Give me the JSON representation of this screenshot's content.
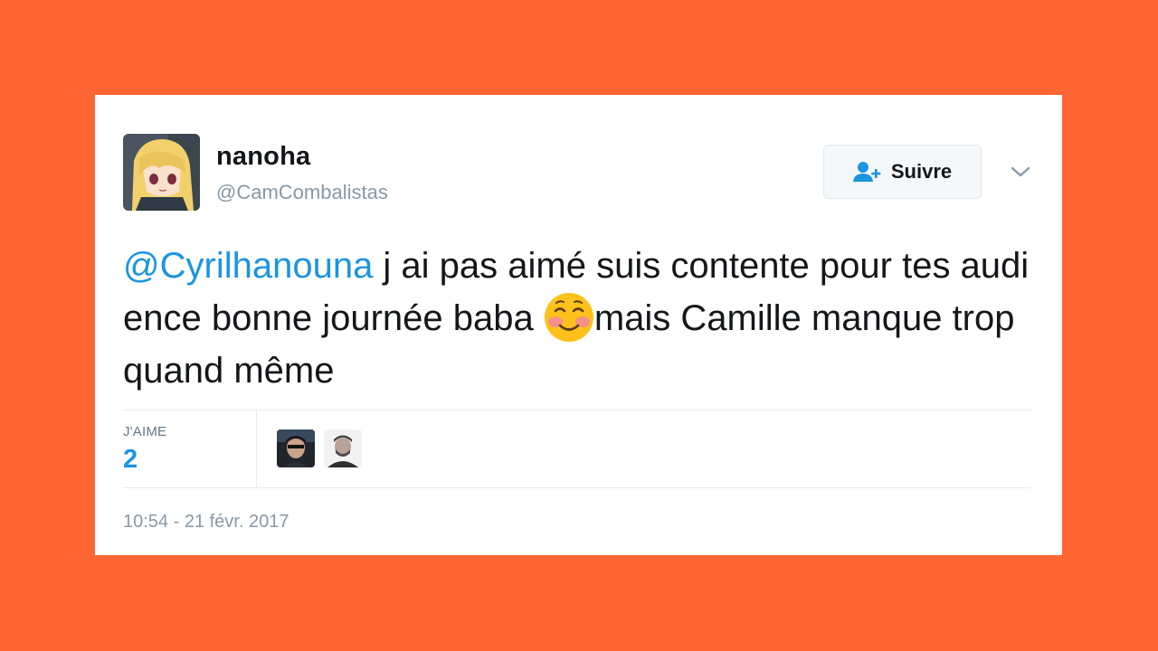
{
  "tweet": {
    "author_name": "nanoha",
    "author_handle": "@CamCombalistas",
    "follow_label": "Suivre",
    "text_mention": "@Cyrilhanouna",
    "text_part1": " j ai pas aimé suis contente pour tes audience bonne journée baba ",
    "text_emoji": "relieved-smiling-face-emoji",
    "text_part2": "mais Camille manque trop quand même",
    "likes_label": "J'AIME",
    "likes_count": "2",
    "timestamp": "10:54 - 21 févr. 2017"
  },
  "colors": {
    "background": "#ff6633",
    "link": "#1b95e0",
    "text": "#14171a",
    "muted": "#8899a6"
  },
  "icons": {
    "follow": "add-user-icon",
    "menu": "chevron-down-icon"
  }
}
